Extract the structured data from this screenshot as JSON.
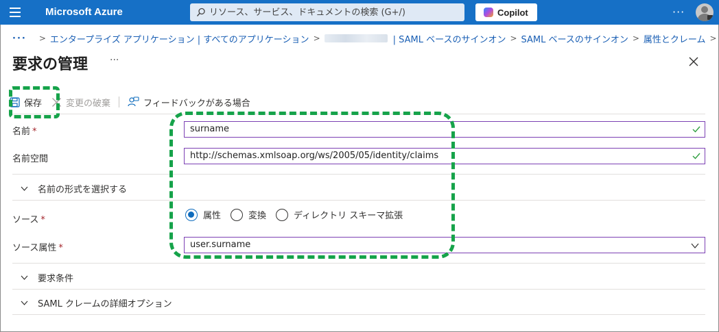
{
  "topbar": {
    "brand": "Microsoft Azure",
    "search_placeholder": "リソース、サービス、ドキュメントの検索 (G+/)",
    "copilot_label": "Copilot",
    "more_label": "···"
  },
  "breadcrumb": {
    "overflow": "···",
    "items": [
      "エンタープライズ アプリケーション | すべてのアプリケーション",
      "| SAML ベースのサインオン",
      "SAML ベースのサインオン",
      "属性とクレーム"
    ],
    "separator": ">"
  },
  "page": {
    "title": "要求の管理",
    "more": "···"
  },
  "toolbar": {
    "save_label": "保存",
    "discard_label": "変更の破棄",
    "feedback_label": "フィードバックがある場合"
  },
  "form": {
    "name_label": "名前",
    "name_value": "surname",
    "namespace_label": "名前空間",
    "namespace_value": "http://schemas.xmlsoap.org/ws/2005/05/identity/claims",
    "name_format_expander": "名前の形式を選択する",
    "source_label": "ソース",
    "source_options": [
      "属性",
      "変換",
      "ディレクトリ スキーマ拡張"
    ],
    "source_selected": "属性",
    "source_attribute_label": "ソース属性",
    "source_attribute_value": "user.surname",
    "claim_conditions_expander": "要求条件",
    "saml_options_expander": "SAML クレームの詳細オプション",
    "required_marker": "*"
  },
  "colors": {
    "topbar": "#1670c6",
    "link": "#1a5fb4",
    "highlight": "#16a34a",
    "radio_selected": "#0f6cbd",
    "input_border": "#7b3fb3",
    "check": "#2e9e3f"
  }
}
